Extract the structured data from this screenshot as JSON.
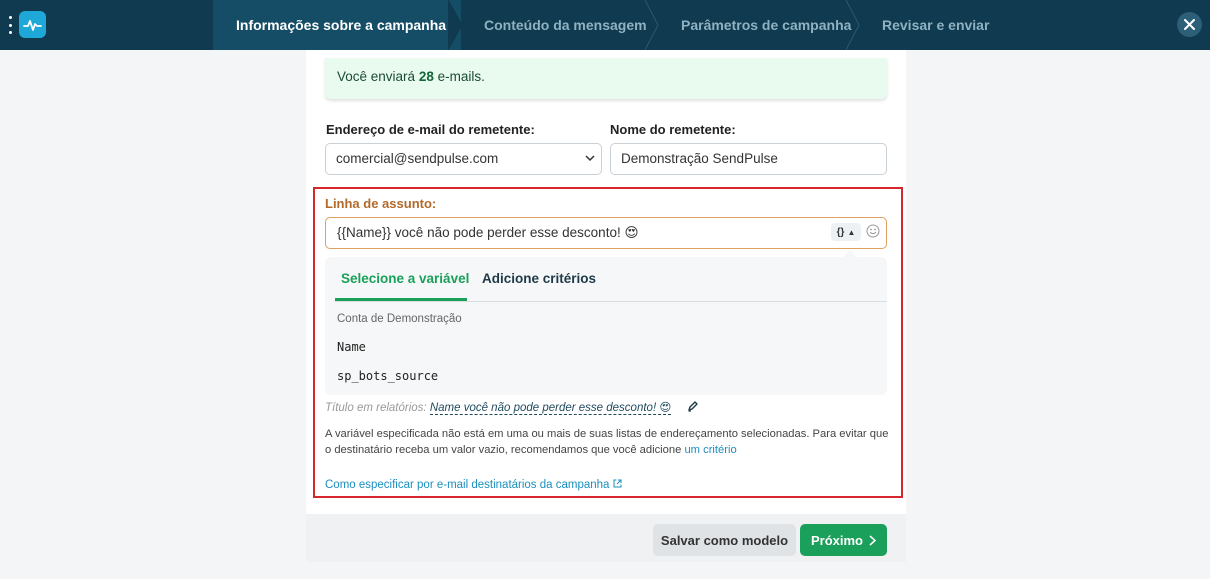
{
  "header": {
    "steps": [
      {
        "label": "Informações sobre a campanha",
        "active": true
      },
      {
        "label": "Conteúdo da mensagem",
        "active": false
      },
      {
        "label": "Parâmetros de campanha",
        "active": false
      },
      {
        "label": "Revisar e enviar",
        "active": false
      }
    ],
    "close_icon": "close-icon"
  },
  "notice": {
    "prefix": "Você enviará",
    "count": "28",
    "suffix": "e-mails."
  },
  "sender": {
    "email_label": "Endereço de e-mail do remetente:",
    "email_value": "comercial@sendpulse.com",
    "name_label": "Nome do remetente:",
    "name_value": "Demonstração SendPulse"
  },
  "subject": {
    "label": "Linha de assunto:",
    "value": "{{Name}} você não pode perder esse desconto! 😍",
    "variable_button": "{}",
    "emoji_icon": "smiley-icon"
  },
  "variables": {
    "tabs": [
      "Selecione a variável",
      "Adicione critérios"
    ],
    "group_title": "Conta de Demonstração",
    "items": [
      "Name",
      "sp_bots_source"
    ]
  },
  "report": {
    "label": "Título em relatórios:",
    "value": "Name você não pode perder esse desconto! 😍"
  },
  "warning": {
    "text": "A variável especificada não está em uma ou mais de suas listas de endereçamento selecionadas. Para evitar que o destinatário receba um valor vazio, recomendamos que você adicione",
    "link": "um critério"
  },
  "help_link": "Como especificar por e-mail destinatários da campanha",
  "footer": {
    "save_template": "Salvar como modelo",
    "next": "Próximo"
  },
  "colors": {
    "topbar": "#0f3a4f",
    "accent_green": "#1aa05a",
    "highlight_red": "#d6262e",
    "link_blue": "#1a8fbf"
  }
}
